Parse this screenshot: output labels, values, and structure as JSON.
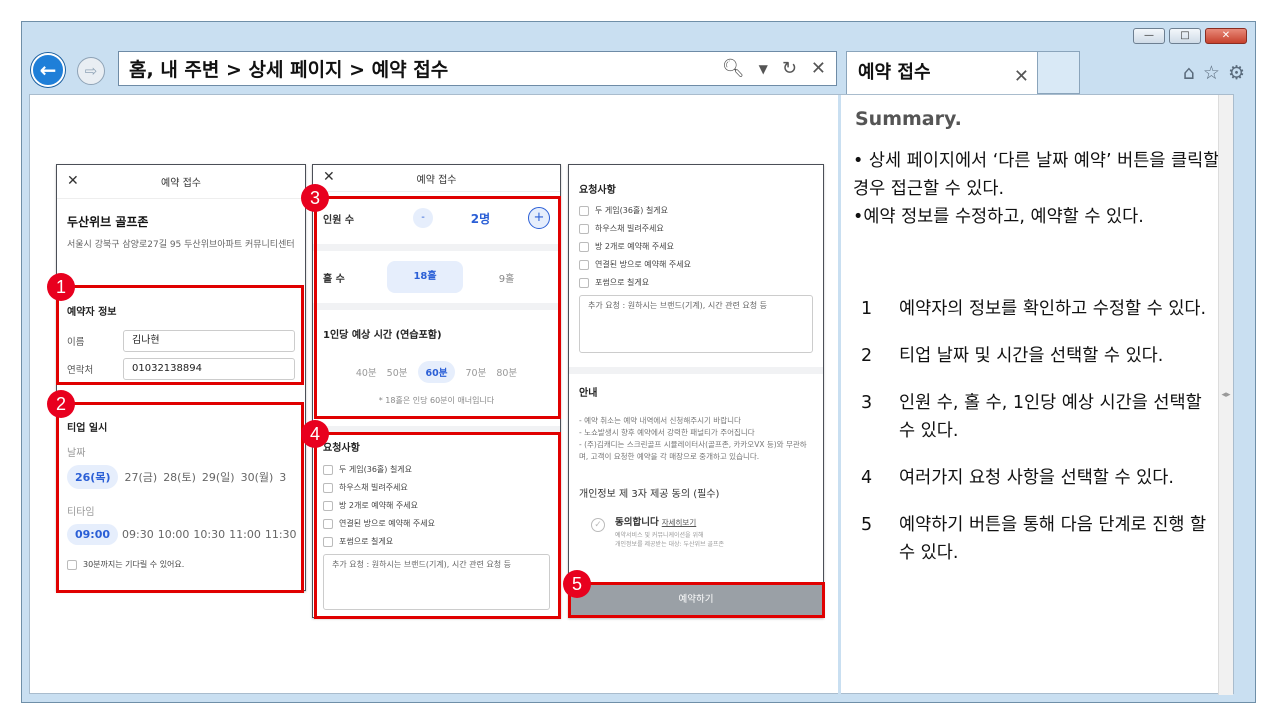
{
  "browser": {
    "address": "홈, 내 주변 > 상세 페이지 > 예약 접수",
    "tab_title": "예약 접수",
    "win_min": "—",
    "win_max": "□",
    "win_close": "✕"
  },
  "summary": {
    "title": "Summary.",
    "line1": "• 상세 페이지에서 ‘다른 날짜 예약’ 버튼을 클릭할 경우 접근할 수 있다.",
    "line2": "•예약 정보를 수정하고, 예약할 수 있다.",
    "steps": [
      {
        "num": "1",
        "text": "예약자의 정보를 확인하고 수정할 수 있다."
      },
      {
        "num": "2",
        "text": "티업 날짜 및 시간을 선택할 수 있다."
      },
      {
        "num": "3",
        "text": "인원 수, 홀 수, 1인당 예상 시간을 선택할 수 있다."
      },
      {
        "num": "4",
        "text": "여러가지 요청 사항을 선택할 수 있다."
      },
      {
        "num": "5",
        "text": "예약하기 버튼을 통해 다음 단계로 진행 할 수 있다."
      }
    ]
  },
  "screen1": {
    "header": "예약 접수",
    "venue": "두산위브 골프존",
    "address": "서울시 강북구 삼양로27길 95 두산위브아파트 커뮤니티센터",
    "booker_title": "예약자 정보",
    "name_label": "이름",
    "name_value": "김나현",
    "phone_label": "연락처",
    "phone_value": "01032138894",
    "teeup_title": "티업 일시",
    "date_label": "날짜",
    "dates": [
      "26(목)",
      "27(금)",
      "28(토)",
      "29(일)",
      "30(월)",
      "3"
    ],
    "time_label": "티타임",
    "times": [
      "09:00",
      "09:30",
      "10:00",
      "10:30",
      "11:00",
      "11:30"
    ],
    "wait_label": "30분까지는 기다릴 수 있어요."
  },
  "screen2": {
    "header": "예약 접수",
    "people_label": "인원 수",
    "people_minus": "-",
    "people_value": "2명",
    "people_plus": "+",
    "holes_label": "홀 수",
    "holes_options": [
      "18홀",
      "9홀"
    ],
    "time_title": "1인당 예상 시간 (연습포함)",
    "time_options": [
      "40분",
      "50분",
      "60분",
      "70분",
      "80분"
    ],
    "time_note": "* 18홀은 인당 60분이 애너입니다",
    "req_title": "요청사항",
    "requests": [
      "두 게임(36홀) 칠게요",
      "하우스채 빌려주세요",
      "방 2개로 예약해 주세요",
      "연결된 방으로 예약해 주세요",
      "포썸으로 칠게요"
    ],
    "textarea": "추가 요청 : 원하시는 브랜드(기계), 시간 관련 요청 등"
  },
  "screen3": {
    "req_title": "요청사항",
    "requests": [
      "두 게임(36홀) 칠게요",
      "하우스채 빌려주세요",
      "방 2개로 예약해 주세요",
      "연결된 방으로 예약해 주세요",
      "포썸으로 칠게요"
    ],
    "textarea": "추가 요청 : 원하시는 브랜드(기계), 시간 관련 요청 등",
    "notice_title": "안내",
    "notice1": "- 예약 취소는 예약 내역에서 신청해주시기 바랍니다",
    "notice2": "- 노쇼발생시 향후 예약에서 강력한 패널티가 주어집니다",
    "notice3": "- (주)김캐디는 스크린골프 시뮬레이터사(골프존, 카카오VX 등)와 무관하며, 고객이 요청한 예약을 각 매장으로 중개하고 있습니다.",
    "consent_title": "개인정보 제 3자 제공 동의 (필수)",
    "agree": "동의합니다",
    "agree_link": "자세히보기",
    "agree_sub1": "예약서비스 및 커뮤니케이션을 위해",
    "agree_sub2": "개인정보를 제공받는 대상: 두산위브 골프존",
    "submit": "예약하기"
  },
  "badges": [
    "1",
    "2",
    "3",
    "4",
    "5"
  ]
}
